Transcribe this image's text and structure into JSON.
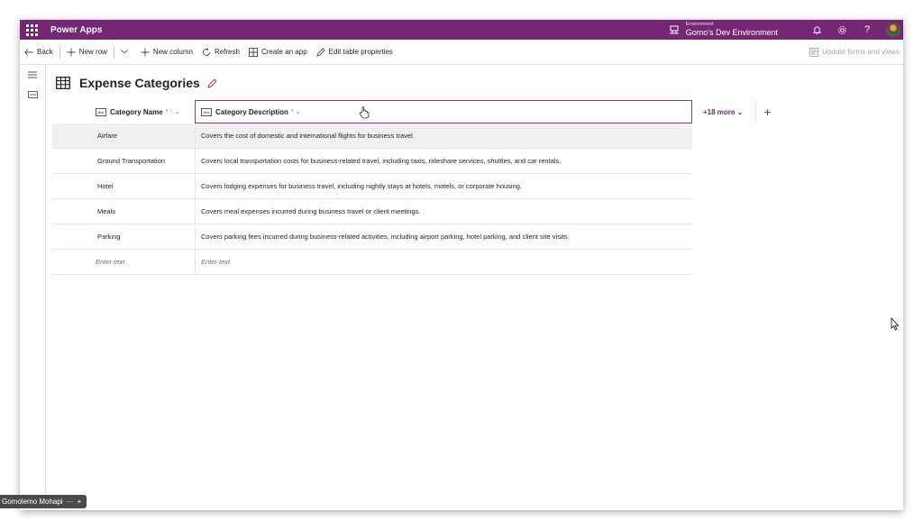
{
  "topbar": {
    "app_title": "Power Apps",
    "environment_label": "Environment",
    "environment_name": "Gomo's Dev Environment",
    "help": "?"
  },
  "commands": {
    "back": "Back",
    "new_row": "New row",
    "new_column": "New column",
    "refresh": "Refresh",
    "create_app": "Create an app",
    "edit_table": "Edit table properties",
    "update_forms": "Update forms and views"
  },
  "page": {
    "title": "Expense Categories"
  },
  "grid": {
    "columns": {
      "name": "Category Name",
      "name_suffix": "* ↑ ⌄",
      "desc": "Category Description",
      "desc_suffix": "* ⌄",
      "more": "+18 more ⌄",
      "add": "+"
    },
    "rows": [
      {
        "name": "Airfare",
        "desc": "Covers the cost of domestic and international flights for business travel."
      },
      {
        "name": "Ground Transportation",
        "desc": "Covers local transportation costs for business-related travel, including taxis, rideshare services, shuttles, and car rentals."
      },
      {
        "name": "Hotel",
        "desc": "Covers lodging expenses for business travel, including nightly stays at hotels, motels, or corporate housing."
      },
      {
        "name": "Meals",
        "desc": "Covers meal expenses incurred during business travel or client meetings."
      },
      {
        "name": "Parking",
        "desc": "Covers parking fees incurred during business-related activities, including airport parking, hotel parking, and client site visits."
      }
    ],
    "placeholder_name": "Enter text",
    "placeholder_desc": "Enter text"
  },
  "taskbar": {
    "user": "Gomolemo Mohapi",
    "dash": "—",
    "plus": "+"
  },
  "colors": {
    "brand": "#742774"
  }
}
